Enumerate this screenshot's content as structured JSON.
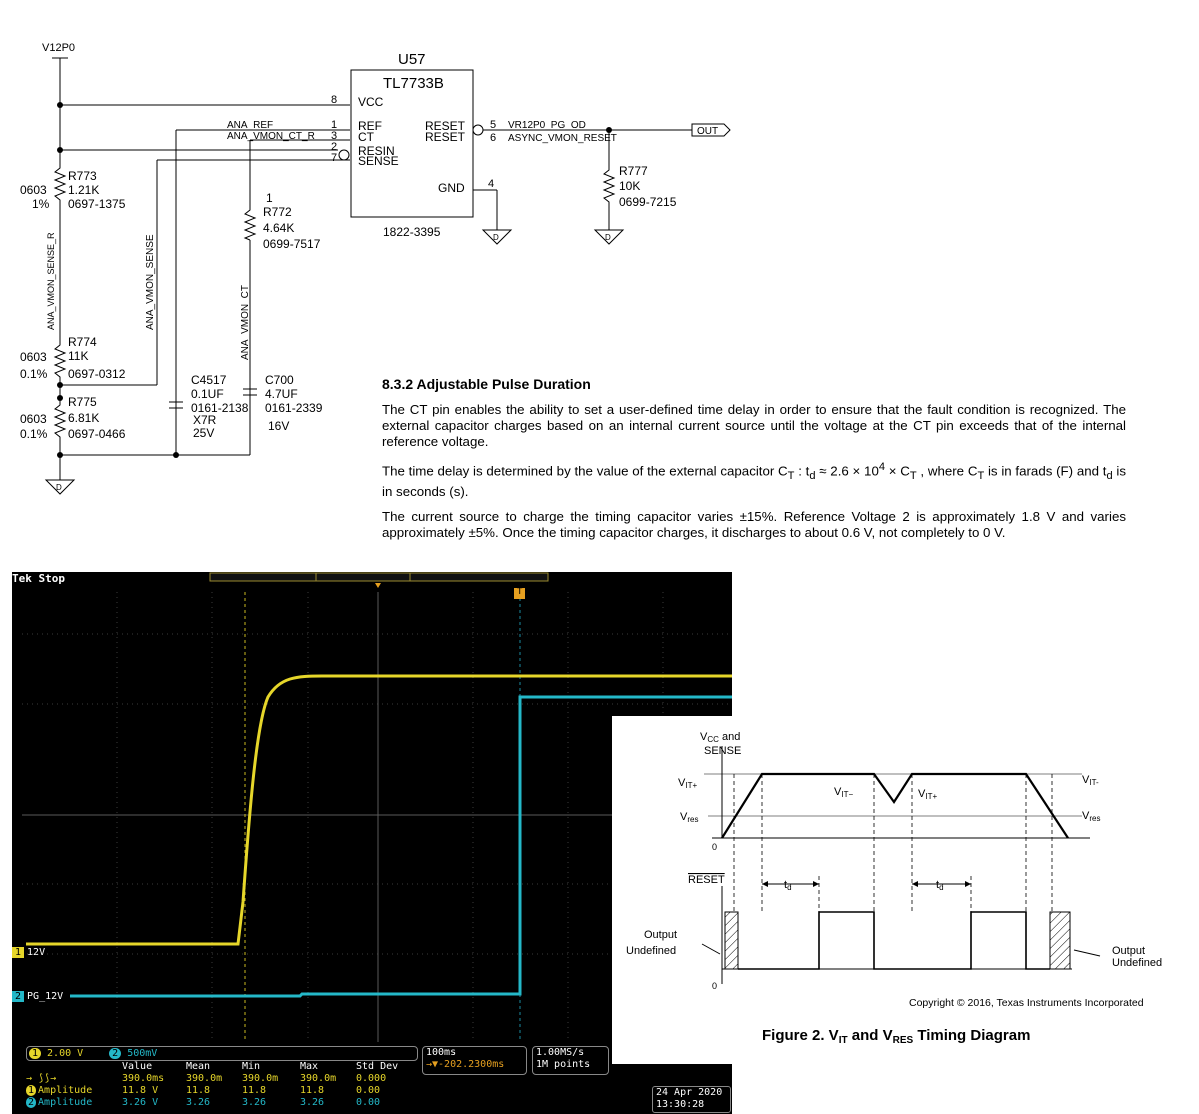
{
  "schematic": {
    "power_net": "V12P0",
    "ic": {
      "ref": "U57",
      "part": "TL7733B",
      "pn": "1822-3395",
      "pins": {
        "vcc_num": "8",
        "vcc": "VCC",
        "ref_num": "1",
        "ref": "REF",
        "ct_num": "3",
        "ct": "CT",
        "resin_num": "2",
        "resin": "RESIN",
        "sense_num": "7",
        "sense": "SENSE",
        "gnd": "GND",
        "gnd_num": "4",
        "reset_a": "RESET",
        "reset_a_num": "5",
        "reset_b": "RESET",
        "reset_b_num": "6"
      }
    },
    "nets": {
      "ana_ref": "ANA_REF",
      "ana_vmon_ct_r": "ANA_VMON_CT_R",
      "pg_od": "VR12P0_PG_OD",
      "async_reset": "ASYNC_VMON_RESET",
      "out": "OUT",
      "sense_r": "ANA_VMON_SENSE_R",
      "sense": "ANA_VMON_SENSE",
      "ct": "ANA_VMON_CT"
    },
    "r773": {
      "ref": "R773",
      "size": "0603",
      "tol": "1%",
      "val": "1.21K",
      "pn": "0697-1375"
    },
    "r774": {
      "ref": "R774",
      "size": "0603",
      "tol": "0.1%",
      "val": "11K",
      "pn": "0697-0312"
    },
    "r775": {
      "ref": "R775",
      "size": "0603",
      "tol": "0.1%",
      "val": "6.81K",
      "pn": "0697-0466"
    },
    "r772": {
      "pin": "1",
      "ref": "R772",
      "val": "4.64K",
      "pn": "0699-7517"
    },
    "r777": {
      "ref": "R777",
      "val": "10K",
      "pn": "0699-7215"
    },
    "c4517": {
      "ref": "C4517",
      "val": "0.1UF",
      "pn": "0161-2138",
      "diel": "X7R",
      "volt": "25V"
    },
    "c700": {
      "ref": "C700",
      "val": "4.7UF",
      "pn": "0161-2339",
      "volt": "16V"
    },
    "gnd_symbol": "D"
  },
  "doc": {
    "heading": "8.3.2   Adjustable Pulse Duration",
    "p1": "The CT pin enables the ability to set a user-defined time delay in order to ensure that the fault condition is recognized. The external capacitor charges based on an internal current source until the voltage at the CT pin exceeds that of the internal reference voltage.",
    "p2_a": "The time delay is determined by the value of the external capacitor C",
    "p2_sub1": "T",
    "p2_b": " : t",
    "p2_sub2": "d",
    "p2_c": " ≈ 2.6 × 10",
    "p2_sup": "4",
    "p2_d": " × C",
    "p2_sub3": "T",
    "p2_e": " , where C",
    "p2_sub4": "T",
    "p2_f": " is in farads (F) and t",
    "p2_sub5": "d",
    "p2_g": " is in seconds (s).",
    "p3": "The current source to charge the timing capacitor varies ±15%. Reference Voltage 2 is approximately 1.8 V and varies approximately ±5%. Once the timing capacitor charges, it discharges to about 0.6 V, not completely to 0 V."
  },
  "scope": {
    "status": "Tek Stop",
    "ch1_label": "12V",
    "ch1_num": "1",
    "ch2_label": "PG_12V",
    "ch2_num": "2",
    "trigger_marker": "T",
    "ch1_scale": "2.00 V",
    "ch2_scale": "500mV",
    "timebase": "100ms",
    "trigger_pos": "→▼-202.2300ms",
    "sample_rate": "1.00MS/s",
    "record": "1M points",
    "date": "24 Apr 2020",
    "time": "13:30:28",
    "table": {
      "headers": [
        "Value",
        "Mean",
        "Min",
        "Max",
        "Std Dev"
      ],
      "rows": [
        {
          "label": "→ ⟆⟆→",
          "values": [
            "390.0ms",
            "390.0m",
            "390.0m",
            "390.0m",
            "0.000"
          ]
        },
        {
          "label": "Amplitude",
          "values": [
            "11.8 V",
            "11.8",
            "11.8",
            "11.8",
            "0.00"
          ]
        },
        {
          "label": "Amplitude",
          "values": [
            "3.26 V",
            "3.26",
            "3.26",
            "3.26",
            "0.00"
          ]
        }
      ]
    },
    "colors": {
      "ch1": "#e6d62a",
      "ch2": "#24b8c8",
      "grid": "#3a3a3a"
    }
  },
  "timing": {
    "vcc_label_1": "V",
    "vcc_label_sub": "CC",
    "vcc_label_2": " and",
    "sense_label": "SENSE",
    "vit_plus_left": "V",
    "vit_plus_sub": "IT+",
    "vres_left": "V",
    "vres_sub": "res",
    "zero_1": "0",
    "zero_2": "0",
    "vit_minus_mid": "V",
    "vit_minus_mid_sub": "IT−",
    "vit_plus_mid": "V",
    "vit_plus_mid_sub": "IT+",
    "vit_minus_right": "V",
    "vit_minus_right_sub": "IT-",
    "vres_right": "V",
    "vres_right_sub": "res",
    "reset_label": "RESET",
    "td_1": "t",
    "td_sub_1": "d",
    "td_2": "t",
    "td_sub_2": "d",
    "output_undefined_left_1": "Output",
    "output_undefined_left_2": "Undefined",
    "output_undefined_right_1": "Output",
    "output_undefined_right_2": "Undefined",
    "copyright": "Copyright © 2016, Texas Instruments Incorporated",
    "caption_a": "Figure 2.  V",
    "caption_sub1": "IT",
    "caption_b": " and V",
    "caption_sub2": "RES",
    "caption_c": " Timing Diagram"
  }
}
